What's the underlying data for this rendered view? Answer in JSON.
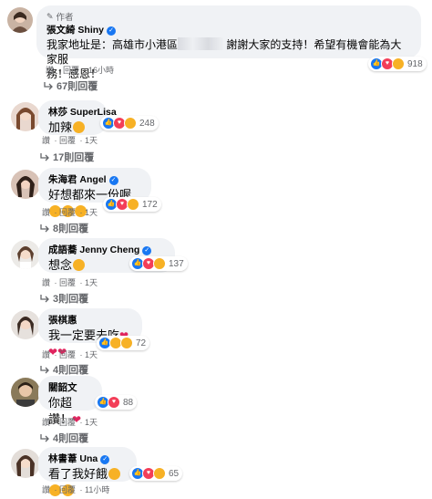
{
  "comments": [
    {
      "author_tag": "作者",
      "name": "張文綺 Shiny",
      "text_part1": "我家地址是：高雄市小港區",
      "text_part2": "謝謝大家的支持！希望有機會能為大家服",
      "text_line2": "務！感恩！",
      "reaction_count": "918",
      "like": "讚",
      "reply": "回覆",
      "time": "16小時",
      "replies": "67則回覆"
    },
    {
      "name": "林莎 SuperLisa",
      "text": "加辣",
      "reaction_count": "248",
      "like": "讚",
      "reply": "回覆",
      "time": "1天",
      "replies": "17則回覆"
    },
    {
      "name": "朱海君 Angel",
      "text": "好想都來一份喔",
      "reaction_count": "172",
      "like": "讚",
      "reply": "回覆",
      "time": "1天",
      "replies": "8則回覆"
    },
    {
      "name": "成語蕎 Jenny Cheng",
      "text": "想念",
      "reaction_count": "137",
      "like": "讚",
      "reply": "回覆",
      "time": "1天",
      "replies": "3則回覆"
    },
    {
      "name": "張棋惠",
      "text": "我一定要去吃",
      "reaction_count": "72",
      "like": "讚",
      "reply": "回覆",
      "time": "1天",
      "replies": "4則回覆"
    },
    {
      "name": "關韶文",
      "text": "你超讚！",
      "reaction_count": "88",
      "like": "讚",
      "reply": "回覆",
      "time": "1天",
      "replies": "4則回覆"
    },
    {
      "name": "林書葦 Una",
      "text": "看了我好餓",
      "reaction_count": "65",
      "like": "讚",
      "reply": "回覆",
      "time": "11小時"
    }
  ],
  "colors": {
    "accent": "#1877f2",
    "bubble": "#f0f2f5",
    "muted": "#65676b",
    "love": "#f33e58",
    "haha": "#f7b125"
  },
  "icons": {
    "verified": "check",
    "reply": "reply-arrow",
    "author": "pen"
  }
}
